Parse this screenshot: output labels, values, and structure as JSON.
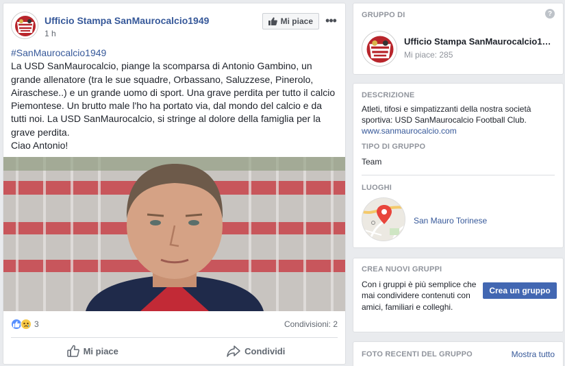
{
  "post": {
    "page_name": "Ufficio Stampa SanMaurocalcio1949",
    "time": "1 h",
    "like_page_label": "Mi piace",
    "more_label": "•••",
    "hashtag": "#SanMaurocalcio1949",
    "paragraphs": [
      "La USD SanMaurocalcio, piange la scomparsa di Antonio Gambino, un grande allenatore (tra le sue squadre, Orbassano, Saluzzese, Pinerolo, Airaschese..) e un grande uomo di sport. Una grave perdita per tutto il calcio Piemontese. Un brutto male l'ho ha portato via, dal mondo del calcio e da tutti noi. La USD SanMaurocalcio, si stringe al dolore della famiglia per la grave perdita.",
      "Ciao Antonio!"
    ],
    "reaction_count": "3",
    "shares_text": "Condivisioni: 2",
    "like_action": "Mi piace",
    "share_action": "Condividi",
    "icons": {
      "avatar": "club-logo",
      "like_page": "thumbs-up-icon",
      "reactions": [
        "like-reaction-icon",
        "sad-reaction-icon"
      ],
      "like_action": "thumbs-up-outline-icon",
      "share_action": "share-arrow-icon"
    }
  },
  "sidebar": {
    "group_card": {
      "title": "GRUPPO DI",
      "help": "?",
      "name": "Ufficio Stampa SanMaurocalcio1…",
      "likes": "Mi piace: 285"
    },
    "desc_card": {
      "desc_title": "DESCRIZIONE",
      "desc_text": "Atleti, tifosi e simpatizzanti della nostra società sportiva: USD SanMaurocalcio Football Club.",
      "link": "www.sanmaurocalcio.com",
      "tipo_title": "TIPO DI GRUPPO",
      "tipo_value": "Team",
      "luoghi_title": "LUOGHI",
      "place": "San Mauro Torinese",
      "map_icon": "map-pin-icon"
    },
    "create_card": {
      "title": "CREA NUOVI GRUPPI",
      "text": "Con i gruppi è più semplice che mai condividere contenuti con amici, familiari e colleghi.",
      "button": "Crea un gruppo"
    },
    "photos_card": {
      "title": "FOTO RECENTI DEL GRUPPO",
      "see_all": "Mostra tutto"
    }
  },
  "colors": {
    "link_blue": "#365899",
    "brand_blue": "#4267b2",
    "background": "#e9ebee",
    "secondary_text": "#90949c"
  }
}
